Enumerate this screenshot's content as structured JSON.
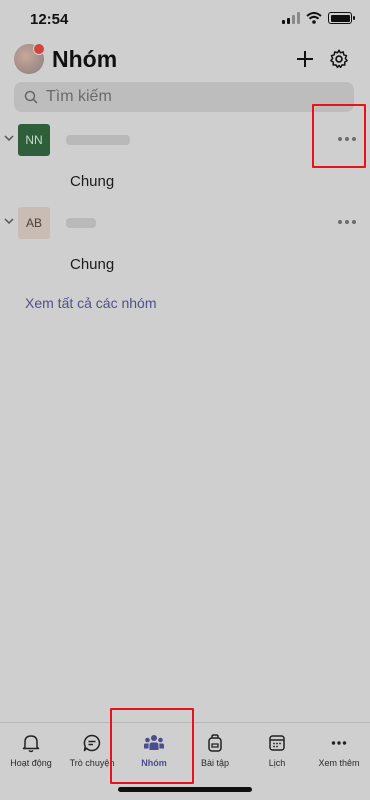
{
  "status": {
    "time": "12:54"
  },
  "header": {
    "title": "Nhóm"
  },
  "search": {
    "placeholder": "Tìm kiếm"
  },
  "teams": [
    {
      "initials": "NN",
      "avatar_color": "#2f5f3a",
      "avatar_text_color": "#c8d8c8",
      "channel": "Chung"
    },
    {
      "initials": "AB",
      "avatar_color": "#c8bcb5",
      "avatar_text_color": "#4a3f39",
      "channel": "Chung"
    }
  ],
  "see_all": "Xem tất cả các nhóm",
  "tabs": [
    {
      "label": "Hoạt động",
      "icon": "bell-icon"
    },
    {
      "label": "Trò chuyện",
      "icon": "chat-icon"
    },
    {
      "label": "Nhóm",
      "icon": "teams-icon",
      "active": true
    },
    {
      "label": "Bài tập",
      "icon": "backpack-icon"
    },
    {
      "label": "Lịch",
      "icon": "calendar-icon"
    },
    {
      "label": "Xem thêm",
      "icon": "more-icon"
    }
  ],
  "colors": {
    "accent": "#4b4d8e",
    "highlight": "#e8121b",
    "background": "#cfcfcf"
  }
}
